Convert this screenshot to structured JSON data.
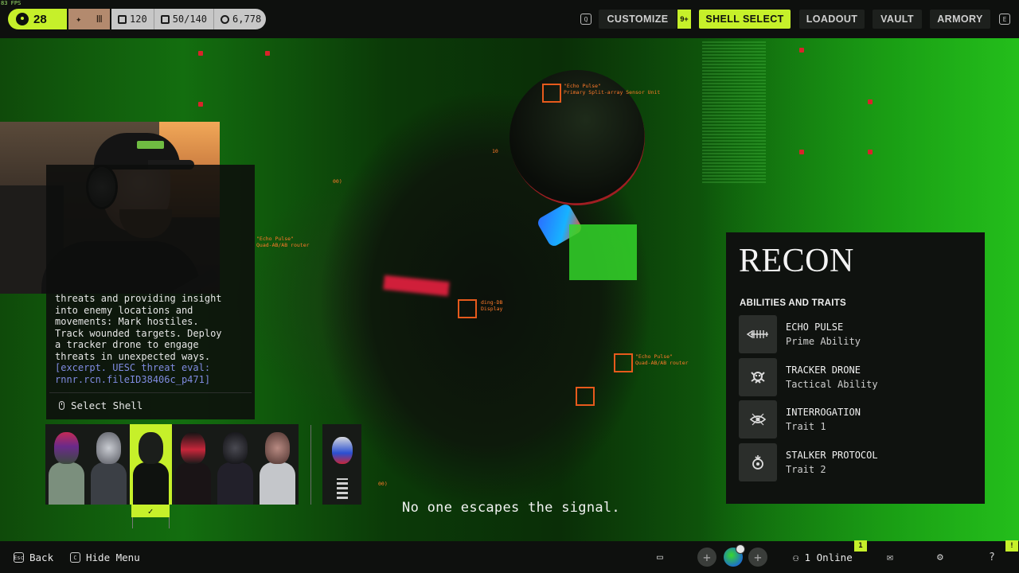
{
  "hud": {
    "fps": "83 FPS",
    "level": "28",
    "squad_icons": [
      "add-player-icon",
      "roman-three-icon"
    ],
    "stats": [
      {
        "icon": "card-icon",
        "value": "120"
      },
      {
        "icon": "stack-icon",
        "value": "50/140"
      },
      {
        "icon": "credits-icon",
        "value": "6,778"
      }
    ]
  },
  "nav": {
    "left_key": "Q",
    "customize": "CUSTOMIZE",
    "customize_badge": "9+",
    "shell_select": "SHELL SELECT",
    "loadout": "LOADOUT",
    "vault": "VAULT",
    "armory": "ARMORY",
    "right_key": "E"
  },
  "scene_labels": [
    "\"Echo Pulse\"\nPrimary Split-array Sensor Unit",
    "\"Echo Pulse\"\nQuad-AB/AB router",
    "ding-DB\nDisplay",
    "\"Echo Pulse\"\nQuad-AB/AB router",
    "10",
    "00)",
    "00)"
  ],
  "description": {
    "text": "threats and providing insight\ninto enemy locations and\nmovements: Mark hostiles.\nTrack wounded targets. Deploy\na tracker drone to engage\nthreats in unexpected ways.",
    "excerpt": "[excerpt. UESC threat eval:\nrnnr.rcn.fileID38406c_p471]",
    "select_label": "Select Shell"
  },
  "roster": {
    "selected_index": 2,
    "check": "✓"
  },
  "subtitle": "No one escapes the signal.",
  "shell": {
    "name": "RECON",
    "section_title": "ABILITIES AND TRAITS",
    "abilities": [
      {
        "name": "ECHO PULSE",
        "type": "Prime Ability",
        "icon": "echo-pulse-icon"
      },
      {
        "name": "TRACKER DRONE",
        "type": "Tactical Ability",
        "icon": "tracker-drone-icon"
      },
      {
        "name": "INTERROGATION",
        "type": "Trait 1",
        "icon": "interrogation-icon"
      },
      {
        "name": "STALKER PROTOCOL",
        "type": "Trait 2",
        "icon": "stalker-protocol-icon"
      }
    ]
  },
  "footer": {
    "back_key": "Esc",
    "back": "Back",
    "hide_key": "C",
    "hide_menu": "Hide Menu",
    "online": "1 Online",
    "notif_online": "1",
    "notif_help": "!"
  },
  "colors": {
    "accent": "#c6f02a",
    "panel": "#0f120f",
    "target": "#e65a1c",
    "excerpt": "#7f8be0"
  }
}
